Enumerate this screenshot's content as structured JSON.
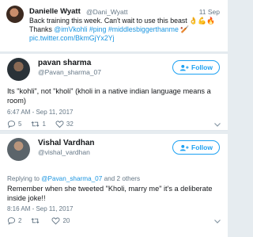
{
  "tweet1": {
    "name": "Danielle Wyatt",
    "handle": "@Dani_Wyatt",
    "date": "11 Sep",
    "line1": "Back training this week. Can't wait to use this beast 👌💪🔥",
    "line2_prefix": "Thanks ",
    "line2_link": "@imVkohli #ping #middlesbiggerthanme",
    "line2_suffix": " 🏏",
    "line3": "pic.twitter.com/BkmGjYx2Yj"
  },
  "tweet2": {
    "name": "pavan sharma",
    "handle": "@Pavan_sharma_07",
    "follow_label": "Follow",
    "text": "Its \"kohli\", not \"kholi\" (kholi in a native indian language means a room)",
    "timestamp": "6:47 AM - Sep 11, 2017",
    "replies": "5",
    "retweets": "1",
    "likes": "32"
  },
  "tweet3": {
    "name": "Vishal Vardhan",
    "handle": "@vishal_vardhan",
    "follow_label": "Follow",
    "reply_to_prefix": "Replying to ",
    "reply_to_link": "@Pavan_sharma_07",
    "reply_to_suffix": " and 2 others",
    "text": "Remember when she tweeted \"Kholi, marry me\" it's a deliberate inside joke!!",
    "timestamp": "8:16 AM - Sep 11, 2017",
    "replies": "2",
    "retweets": "",
    "likes": "20"
  },
  "colors": {
    "accent": "#1da1f2",
    "secondary_text": "#657786",
    "divider": "#e1e8ed",
    "background": "#e6ecf0"
  },
  "icons": [
    "reply-icon",
    "retweet-icon",
    "like-icon",
    "more-icon",
    "follow-person-icon"
  ]
}
